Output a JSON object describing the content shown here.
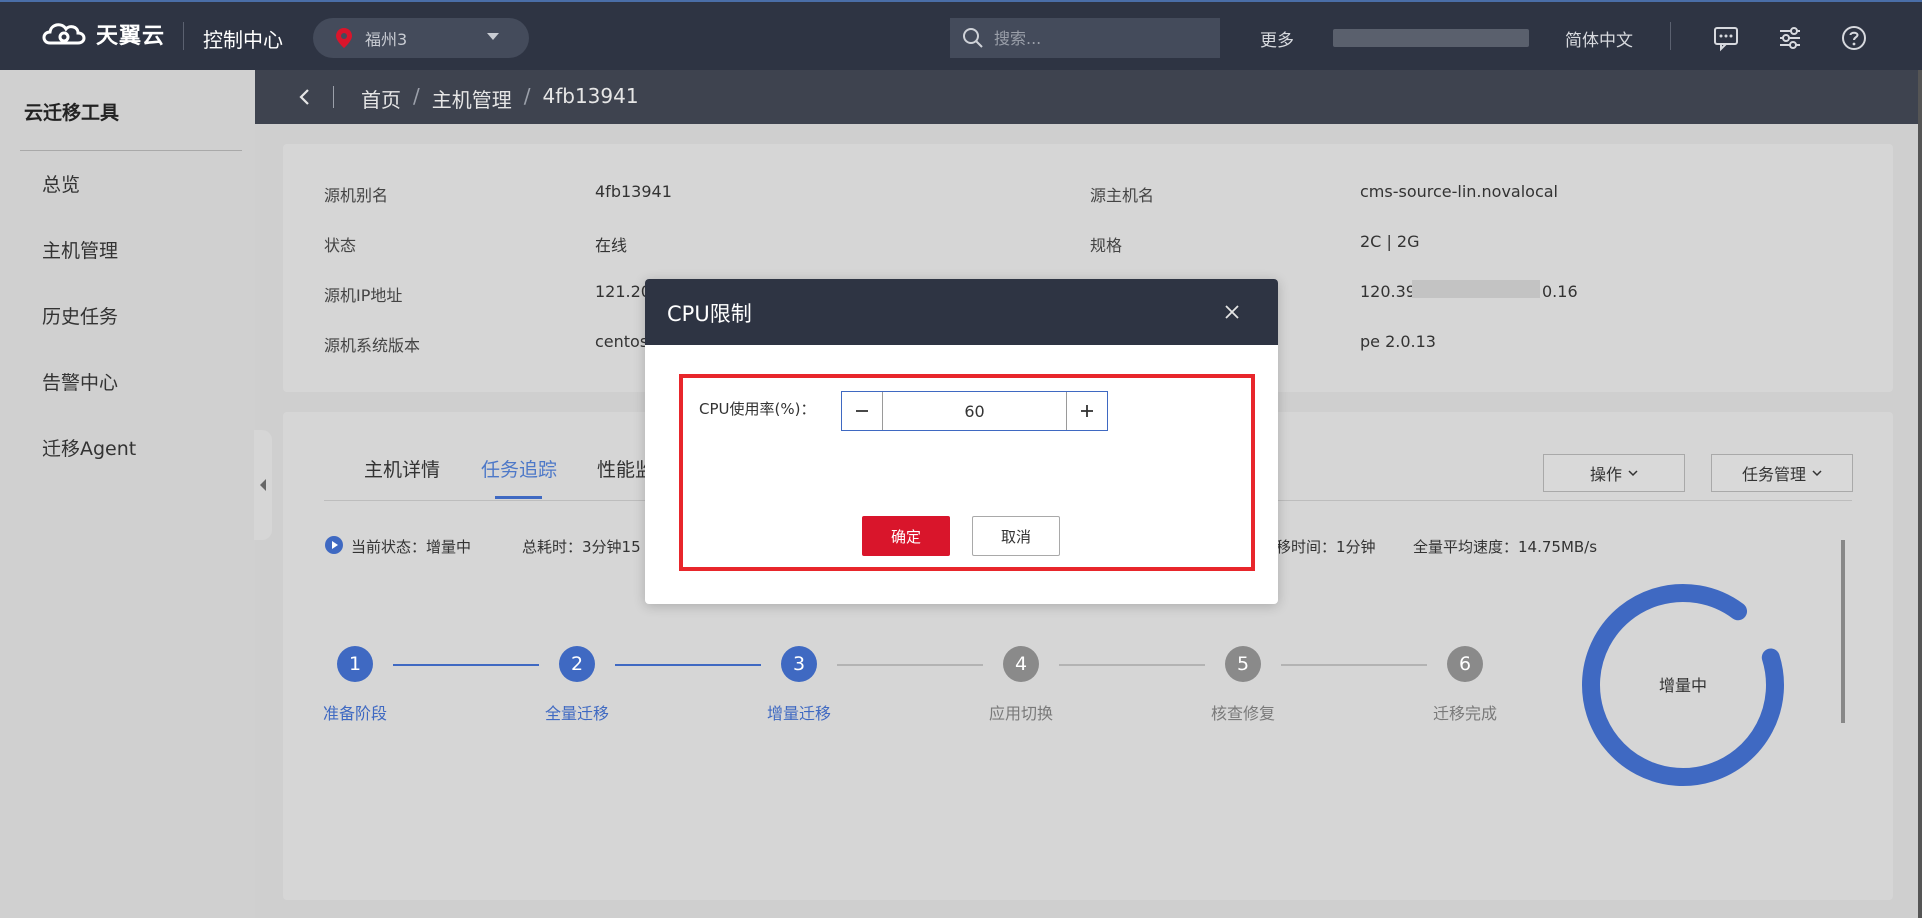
{
  "brand": {
    "name": "天翼云",
    "console": "控制中心"
  },
  "region": {
    "label": "福州3"
  },
  "search": {
    "placeholder": "搜索..."
  },
  "header_links": {
    "more": "更多",
    "language": "简体中文"
  },
  "sidebar": {
    "title": "云迁移工具",
    "items": [
      {
        "label": "总览"
      },
      {
        "label": "主机管理"
      },
      {
        "label": "历史任务"
      },
      {
        "label": "告警中心"
      },
      {
        "label": "迁移Agent"
      }
    ]
  },
  "breadcrumb": {
    "home": "首页",
    "section": "主机管理",
    "current": "4fb13941"
  },
  "info": {
    "alias_label": "源机别名",
    "alias_value": "4fb13941",
    "status_label": "状态",
    "status_value": "在线",
    "ip_label": "源机IP地址",
    "ip_value": "121.20",
    "os_label": "源机系统版本",
    "os_value": "centos",
    "hostname_label": "源主机名",
    "hostname_value": "cms-source-lin.novalocal",
    "spec_label": "规格",
    "spec_value": "2C | 2G",
    "target_ip_prefix": "120.39.",
    "target_ip_suffix": "0.16",
    "agent_version_value": "pe 2.0.13"
  },
  "tabs": [
    {
      "label": "主机详情"
    },
    {
      "label": "任务追踪"
    },
    {
      "label": "性能监"
    }
  ],
  "actions": {
    "operate": "操作",
    "task_manage": "任务管理"
  },
  "status": {
    "current": "当前状态：增量中",
    "total_time": "总耗时：3分钟15",
    "migrate_time": "移时间：1分钟",
    "avg_speed": "全量平均速度：14.75MB/s"
  },
  "steps": [
    {
      "num": "1",
      "label": "准备阶段",
      "state": "done"
    },
    {
      "num": "2",
      "label": "全量迁移",
      "state": "done"
    },
    {
      "num": "3",
      "label": "增量迁移",
      "state": "done"
    },
    {
      "num": "4",
      "label": "应用切换",
      "state": "todo"
    },
    {
      "num": "5",
      "label": "核查修复",
      "state": "todo"
    },
    {
      "num": "6",
      "label": "迁移完成",
      "state": "todo"
    }
  ],
  "ring": {
    "label": "增量中",
    "progress": 0.9
  },
  "modal": {
    "title": "CPU限制",
    "field_label": "CPU使用率(%)：",
    "value": "60",
    "confirm": "确定",
    "cancel": "取消"
  },
  "colors": {
    "accent": "#3f69c2",
    "danger": "#d9152b",
    "header_bg": "#2e3443"
  }
}
